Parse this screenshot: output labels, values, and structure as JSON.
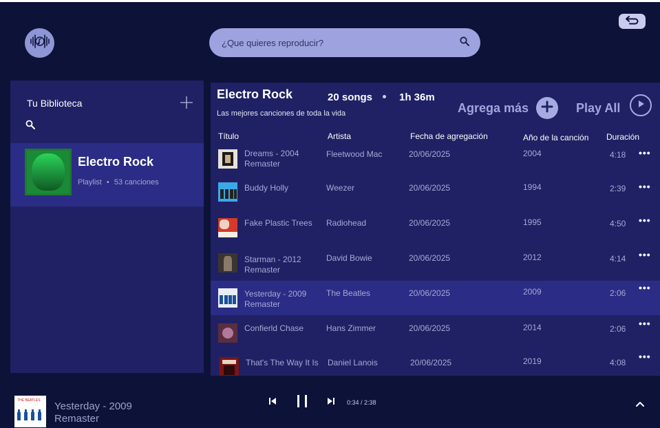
{
  "header": {
    "logo_icon": "music-note-waveform-icon",
    "search_placeholder": "¿Que quieres reproducir?",
    "search_icon": "search-icon",
    "back_icon": "undo-arrow-icon"
  },
  "library": {
    "title": "Tu Biblioteca",
    "add_icon": "plus-icon",
    "search_icon": "search-icon",
    "items": [
      {
        "name": "Electro Rock",
        "type": "Playlist",
        "count": "53 canciones"
      }
    ]
  },
  "playlist": {
    "title": "Electro Rock",
    "description": "Las mejores canciones de toda la vida",
    "songs": "20 songs",
    "duration": "1h 36m",
    "add_more_label": "Agrega más",
    "play_all_label": "Play All",
    "columns": {
      "title": "Título",
      "artist": "Artista",
      "date_added": "Fecha de agregación",
      "year": "Año de la canción",
      "duration": "Duración"
    },
    "tracks": [
      {
        "title": "Dreams - 2004 Remaster",
        "artist": "Fleetwood Mac",
        "date": "20/06/2025",
        "year": "2004",
        "duration": "4:18",
        "more": "•••"
      },
      {
        "title": "Buddy Holly",
        "artist": "Weezer",
        "date": "20/06/2025",
        "year": "1994",
        "duration": "2:39",
        "more": "•••"
      },
      {
        "title": "Fake Plastic Trees",
        "artist": "Radiohead",
        "date": "20/06/2025",
        "year": "1995",
        "duration": "4:50",
        "more": "•••"
      },
      {
        "title": "Starman - 2012 Remaster",
        "artist": "David Bowie",
        "date": "20/06/2025",
        "year": "2012",
        "duration": "4:14",
        "more": "•••"
      },
      {
        "title": "Yesterday - 2009 Remaster",
        "artist": "The Beatles",
        "date": "20/06/2025",
        "year": "2009",
        "duration": "2:06",
        "more": "•••"
      },
      {
        "title": "Confierld Chase",
        "artist": "Hans Zimmer",
        "date": "20/06/2025",
        "year": "2014",
        "duration": "2:06",
        "more": "•••"
      },
      {
        "title": "That's The Way It Is",
        "artist": "Daniel Lanois",
        "date": "20/06/2025",
        "year": "2019",
        "duration": "4:08",
        "more": "•••"
      }
    ],
    "active_track": "Yesterday - 2009 Remaster"
  },
  "player": {
    "now_playing_title": "Yesterday - 2009 Remaster",
    "time": "0:34 / 2:38",
    "icons": [
      "skip-previous-icon",
      "pause-icon",
      "skip-next-icon",
      "chevron-up-icon"
    ]
  },
  "colors": {
    "background": "#0d1238",
    "panel": "#1f2164",
    "highlight": "#2a2c85",
    "accent": "#a6aae2",
    "search_bg": "#9ea3e0"
  }
}
